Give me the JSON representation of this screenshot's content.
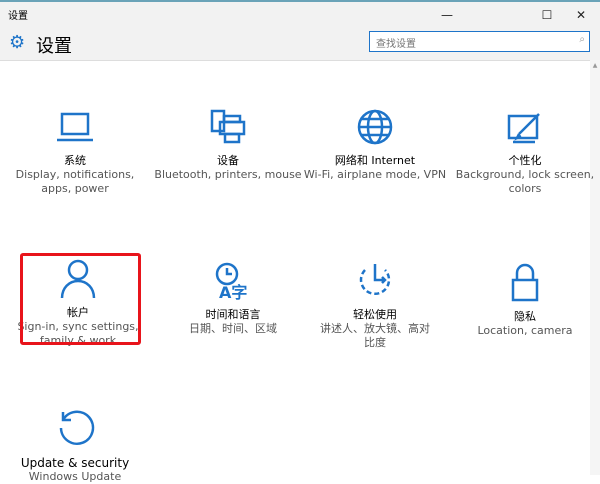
{
  "window": {
    "title": "设置",
    "minimize": "—",
    "maximize": "☐",
    "close": "✕"
  },
  "header": {
    "title": "设置",
    "icon": "gear-icon",
    "search_placeholder": "查找设置",
    "search_icon": "⌕"
  },
  "accent": "#1e74c9",
  "tiles": [
    {
      "title": "系统",
      "desc": "Display, notifications, apps, power",
      "icon": "laptop-icon"
    },
    {
      "title": "设备",
      "desc": "Bluetooth, printers, mouse",
      "icon": "devices-icon"
    },
    {
      "title": "网络和 Internet",
      "desc": "Wi-Fi, airplane mode, VPN",
      "icon": "globe-icon"
    },
    {
      "title": "个性化",
      "desc": "Background, lock screen, colors",
      "icon": "paint-icon"
    },
    {
      "title": "帐户",
      "desc": "Sign-in, sync settings, family & work",
      "icon": "person-icon",
      "highlighted": true
    },
    {
      "title": "时间和语言",
      "desc": "日期、时间、区域",
      "icon": "time-language-icon"
    },
    {
      "title": "轻松使用",
      "desc": "讲述人、放大镜、高对比度",
      "icon": "ease-of-access-icon"
    },
    {
      "title": "隐私",
      "desc": "Location, camera",
      "icon": "lock-icon"
    },
    {
      "title": "Update & security",
      "desc": "Windows Update",
      "icon": "update-icon"
    }
  ]
}
